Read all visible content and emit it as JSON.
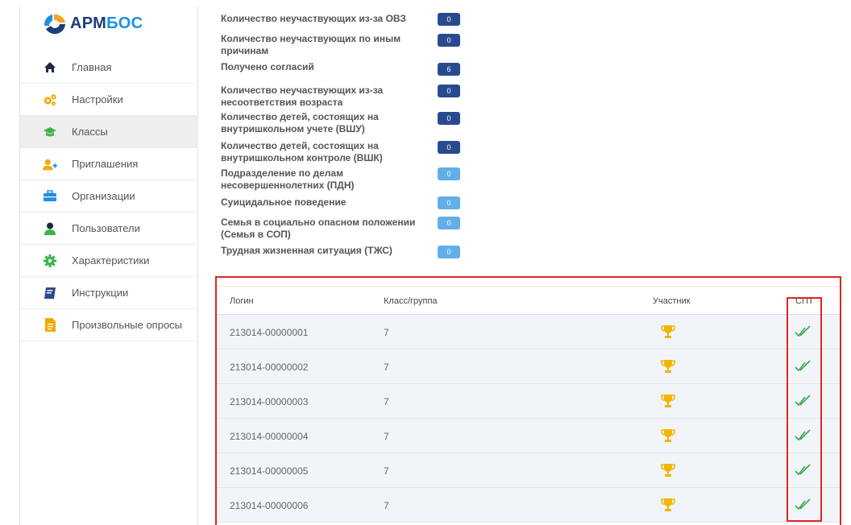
{
  "app": {
    "logo_part1": "АРМ",
    "logo_part2": "БОС"
  },
  "sidebar": {
    "items": [
      {
        "label": "Главная",
        "icon": "home-icon"
      },
      {
        "label": "Настройки",
        "icon": "gears-icon"
      },
      {
        "label": "Классы",
        "icon": "graduation-cap-icon",
        "active": true
      },
      {
        "label": "Приглашения",
        "icon": "user-plus-icon"
      },
      {
        "label": "Организации",
        "icon": "briefcase-icon"
      },
      {
        "label": "Пользователи",
        "icon": "user-icon"
      },
      {
        "label": "Характеристики",
        "icon": "cog-icon"
      },
      {
        "label": "Инструкции",
        "icon": "book-icon"
      },
      {
        "label": "Произвольные опросы",
        "icon": "document-icon"
      }
    ]
  },
  "stats": [
    {
      "label": "Количество неучаствующих из-за ОВЗ",
      "value": "0",
      "style": "dark"
    },
    {
      "label": "Количество неучаствующих по иным причинам",
      "value": "0",
      "style": "dark"
    },
    {
      "label": "Получено согласий",
      "value": "6",
      "style": "dark"
    },
    {
      "label": "Количество неучаствующих из-за несоответствия возраста",
      "value": "0",
      "style": "dark"
    },
    {
      "label": "Количество детей, состоящих на внутришкольном учете (ВШУ)",
      "value": "0",
      "style": "dark"
    },
    {
      "label": "Количество детей, состоящих на внутришкольном контроле (ВШК)",
      "value": "0",
      "style": "dark"
    },
    {
      "label": "Подразделение по делам несовершеннолетних (ПДН)",
      "value": "0",
      "style": "light"
    },
    {
      "label": "Суицидальное поведение",
      "value": "0",
      "style": "light"
    },
    {
      "label": "Семья в социально опасном положении (Семья в СОП)",
      "value": "0",
      "style": "light"
    },
    {
      "label": "Трудная жизненная ситуация (ТЖС)",
      "value": "0",
      "style": "light"
    }
  ],
  "table": {
    "headers": {
      "login": "Логин",
      "class": "Класс/группа",
      "participant": "Участник",
      "spt": "СПТ"
    },
    "rows": [
      {
        "login": "213014-00000001",
        "class": "7"
      },
      {
        "login": "213014-00000002",
        "class": "7"
      },
      {
        "login": "213014-00000003",
        "class": "7"
      },
      {
        "login": "213014-00000004",
        "class": "7"
      },
      {
        "login": "213014-00000005",
        "class": "7"
      },
      {
        "login": "213014-00000006",
        "class": "7"
      }
    ]
  },
  "colors": {
    "trophy": "#f2b600",
    "check": "#3aa84a",
    "highlight": "#e02424",
    "badge_dark": "#2a4a90",
    "badge_light": "#62aee8"
  }
}
